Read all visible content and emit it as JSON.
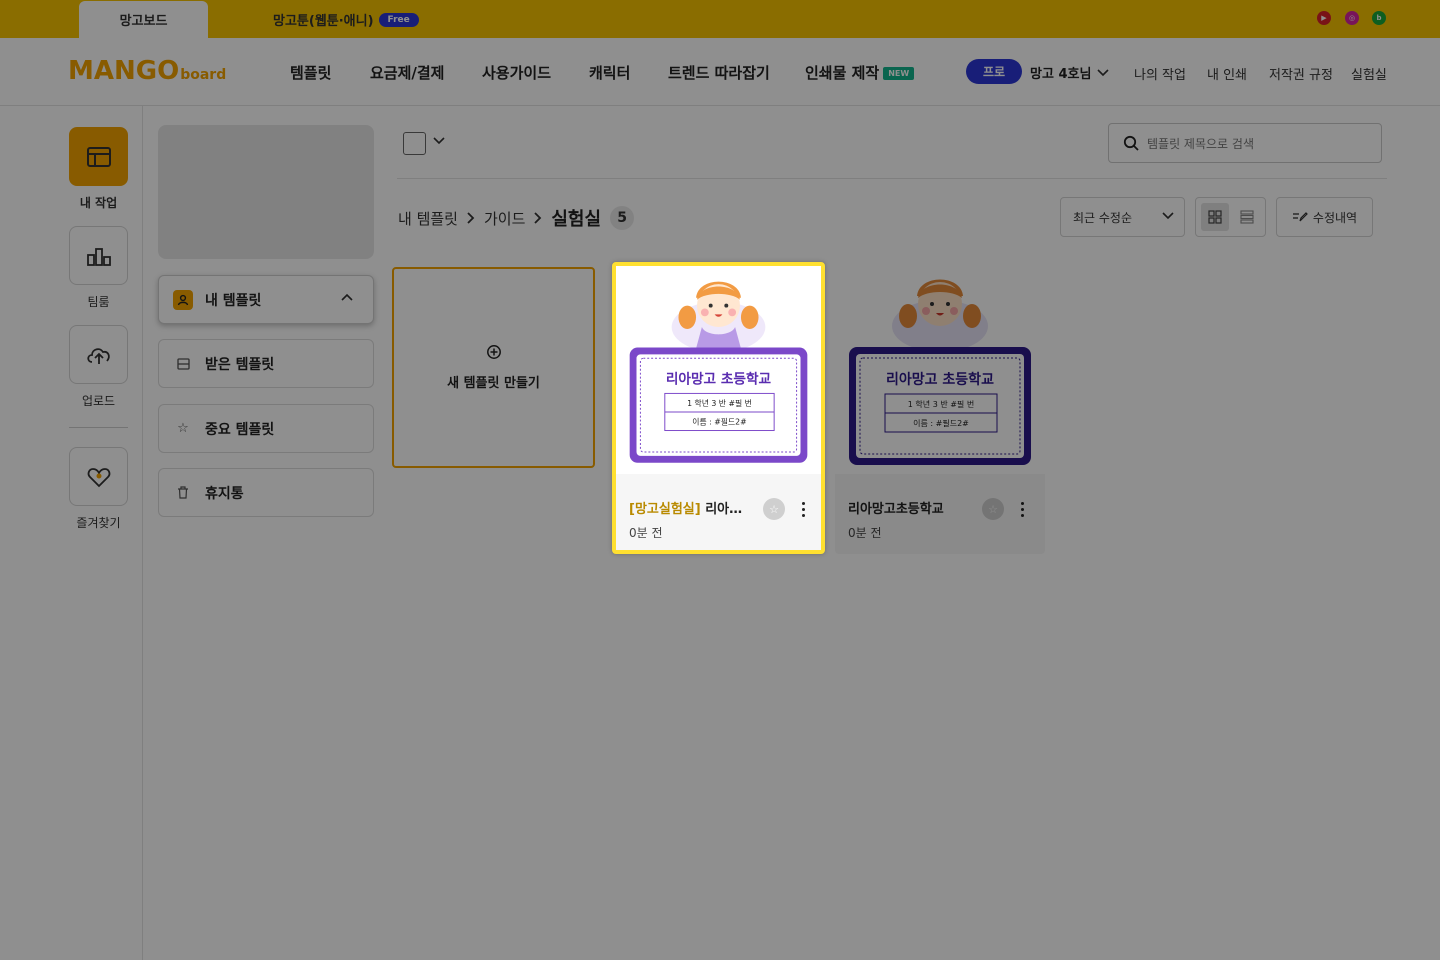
{
  "topbar": {
    "tab_main": "망고보드",
    "tab_toon": "망고툰(웹툰·애니)",
    "free_badge": "Free",
    "social_icons": [
      "youtube-icon",
      "instagram-icon",
      "blog-icon"
    ]
  },
  "header": {
    "logo_main": "MANGO",
    "logo_sub": "board",
    "nav": [
      "템플릿",
      "요금제/결제",
      "사용가이드",
      "캐릭터",
      "트렌드 따라잡기",
      "인쇄물 제작"
    ],
    "new_badge": "NEW",
    "pro_badge": "프로",
    "user_name": "망고 4호님",
    "right_nav": [
      "나의 작업",
      "내 인쇄",
      "저작권 규정",
      "실험실"
    ]
  },
  "rail": {
    "items": [
      {
        "label": "내 작업",
        "icon": "workspace-icon",
        "active": true
      },
      {
        "label": "팀룸",
        "icon": "team-icon",
        "active": false
      },
      {
        "label": "업로드",
        "icon": "upload-cloud-icon",
        "active": false
      },
      {
        "label": "즐겨찾기",
        "icon": "heart-icon",
        "active": false
      }
    ]
  },
  "sidebar": {
    "items": [
      {
        "label": "내 템플릿",
        "icon": "user-icon"
      },
      {
        "label": "받은 템플릿",
        "icon": "inbox-icon"
      },
      {
        "label": "중요 템플릿",
        "icon": "star-icon"
      },
      {
        "label": "휴지통",
        "icon": "trash-icon"
      }
    ]
  },
  "main": {
    "search_placeholder": "템플릿 제목으로 검색",
    "breadcrumb": [
      "내 템플릿",
      "가이드",
      "실험실"
    ],
    "count": "5",
    "sort_label": "최근 수정순",
    "history_label": "수정내역",
    "new_template_label": "새 템플릿 만들기",
    "cards": [
      {
        "tag": "[망고실험실]",
        "title": " 리아망...",
        "time": "0분 전",
        "selected": true,
        "board_color": "#7b48c9",
        "school": "리아망고 초등학교",
        "row1": "1 학년 3 반 #필 번",
        "row2": "이름 : #필드2#"
      },
      {
        "tag": "",
        "title": "리아망고초등학교",
        "time": "0분 전",
        "selected": false,
        "board_color": "#2e1a8a",
        "school": "리아망고 초등학교",
        "row1": "1 학년 3 반 #필 번",
        "row2": "이름 : #필드2#"
      }
    ]
  },
  "colors": {
    "brand": "#f3a300",
    "accent_blue": "#2b37d6",
    "highlight": "#ffe030"
  }
}
